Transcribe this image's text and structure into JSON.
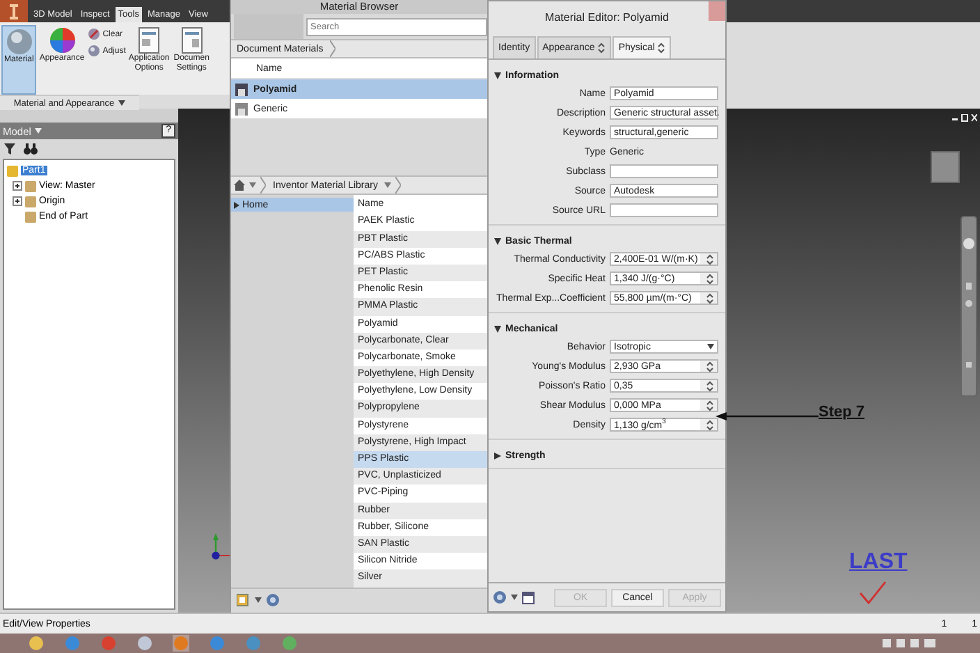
{
  "ribbon": {
    "tabs": [
      {
        "label": "3D Model",
        "selected": false
      },
      {
        "label": "Inspect",
        "selected": false
      },
      {
        "label": "Tools",
        "selected": true
      },
      {
        "label": "Manage",
        "selected": false
      },
      {
        "label": "View",
        "selected": false
      }
    ],
    "buttons": [
      {
        "kind": "large",
        "lines": [
          "Material"
        ],
        "selected": true
      },
      {
        "kind": "large",
        "lines": [
          "Appearance"
        ],
        "selected": false
      },
      {
        "kind": "small",
        "lines": [
          "Clear"
        ],
        "selected": false
      },
      {
        "kind": "small",
        "lines": [
          "Adjust"
        ],
        "selected": false
      },
      {
        "kind": "large",
        "lines": [
          "Application",
          "Options"
        ],
        "selected": false
      },
      {
        "kind": "large",
        "lines": [
          "Documen",
          "Settings"
        ],
        "selected": false
      }
    ],
    "panel_label": "Material and Appearance"
  },
  "model": {
    "title": "Model",
    "help": "?",
    "tree": [
      {
        "label": "Part1",
        "selected": true,
        "children": [
          {
            "label": "View: Master",
            "expanded": false,
            "selected": false
          },
          {
            "label": "Origin",
            "expanded": false,
            "selected": false
          },
          {
            "label": "End of Part",
            "selected": false
          }
        ]
      }
    ]
  },
  "material_browser": {
    "title": "Material Browser",
    "search": {
      "placeholder": "Search"
    },
    "document_materials": {
      "breadcrumb": "Document Materials",
      "header": "Name",
      "rows": [
        {
          "name": "Polyamid",
          "selected": true
        },
        {
          "name": "Generic",
          "selected": false
        }
      ]
    },
    "library": {
      "breadcrumb": "Inventor Material Library",
      "sidebar": [
        {
          "label": "Home",
          "selected": true
        }
      ],
      "header": "Name",
      "rows": [
        {
          "name": "PAEK Plastic",
          "selected": false
        },
        {
          "name": "PBT Plastic",
          "selected": false
        },
        {
          "name": "PC/ABS Plastic",
          "selected": false
        },
        {
          "name": "PET Plastic",
          "selected": false
        },
        {
          "name": "Phenolic Resin",
          "selected": false
        },
        {
          "name": "PMMA Plastic",
          "selected": false
        },
        {
          "name": "Polyamid",
          "selected": false
        },
        {
          "name": "Polycarbonate, Clear",
          "selected": false
        },
        {
          "name": "Polycarbonate, Smoke",
          "selected": false
        },
        {
          "name": "Polyethylene, High Density",
          "selected": false
        },
        {
          "name": "Polyethylene, Low Density",
          "selected": false
        },
        {
          "name": "Polypropylene",
          "selected": false
        },
        {
          "name": "Polystyrene",
          "selected": false
        },
        {
          "name": "Polystyrene, High Impact",
          "selected": false
        },
        {
          "name": "PPS Plastic",
          "selected": true
        },
        {
          "name": "PVC, Unplasticized",
          "selected": false
        },
        {
          "name": "PVC-Piping",
          "selected": false
        },
        {
          "name": "Rubber",
          "selected": false
        },
        {
          "name": "Rubber, Silicone",
          "selected": false
        },
        {
          "name": "SAN Plastic",
          "selected": false
        },
        {
          "name": "Silicon Nitride",
          "selected": false
        },
        {
          "name": "Silver",
          "selected": false
        }
      ]
    }
  },
  "material_editor": {
    "title": "Material Editor: Polyamid",
    "tabs": [
      {
        "label": "Identity",
        "selected": false,
        "menu": false
      },
      {
        "label": "Appearance",
        "selected": false,
        "menu": true
      },
      {
        "label": "Physical",
        "selected": true,
        "menu": true
      }
    ],
    "sections": [
      {
        "title": "Information",
        "expanded": true,
        "fields": [
          {
            "label": "Name",
            "kind": "text",
            "value": "Polyamid"
          },
          {
            "label": "Description",
            "kind": "text",
            "value": "Generic structural asset."
          },
          {
            "label": "Keywords",
            "kind": "text",
            "value": "structural,generic"
          },
          {
            "label": "Type",
            "kind": "static",
            "value": "Generic"
          },
          {
            "label": "Subclass",
            "kind": "text"
          },
          {
            "label": "Source",
            "kind": "text",
            "value": "Autodesk"
          },
          {
            "label": "Source URL",
            "kind": "text"
          }
        ]
      },
      {
        "title": "Basic Thermal",
        "expanded": true,
        "fields": [
          {
            "label": "Thermal Conductivity",
            "kind": "spinner",
            "value": "2,400E-01 W/(m·K)"
          },
          {
            "label": "Specific Heat",
            "kind": "spinner",
            "value": "1,340 J/(g·°C)"
          },
          {
            "label": "Thermal Exp...Coefficient",
            "kind": "spinner",
            "value": "55,800 µm/(m·°C)"
          }
        ]
      },
      {
        "title": "Mechanical",
        "expanded": true,
        "fields": [
          {
            "label": "Behavior",
            "kind": "select",
            "value": "Isotropic"
          },
          {
            "label": "Young's Modulus",
            "kind": "spinner",
            "value": "2,930 GPa"
          },
          {
            "label": "Poisson's Ratio",
            "kind": "spinner",
            "value": "0,35"
          },
          {
            "label": "Shear Modulus",
            "kind": "spinner",
            "value": "0,000 MPa"
          },
          {
            "label": "Density",
            "kind": "spinner",
            "value": "1,130 g/cm$^{3}$"
          }
        ]
      },
      {
        "title": "Strength",
        "expanded": false
      }
    ],
    "buttons": [
      {
        "label": "OK",
        "disabled": true
      },
      {
        "label": "Cancel",
        "disabled": false
      },
      {
        "label": "Apply",
        "disabled": true
      }
    ]
  },
  "annotations": {
    "step": "Step 7",
    "last": "LAST"
  },
  "status_bar": {
    "text": "Edit/View Properties",
    "counters": [
      "1",
      "1"
    ]
  }
}
